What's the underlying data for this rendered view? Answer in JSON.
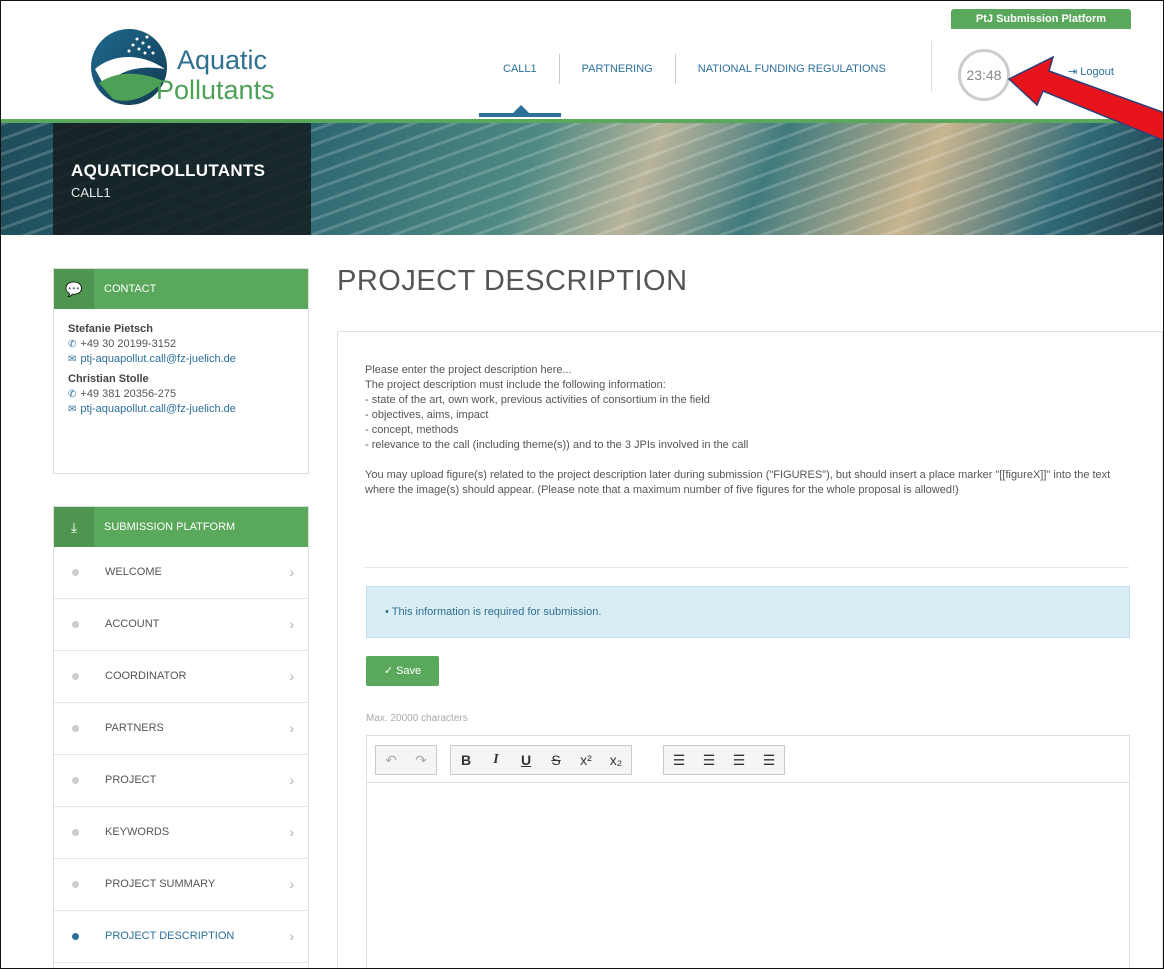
{
  "header": {
    "platform_label": "PtJ Submission Platform",
    "logo": {
      "line1": "Aquatic",
      "line2": "Pollutants"
    },
    "nav": [
      {
        "label": "CALL1",
        "active": true
      },
      {
        "label": "PARTNERING",
        "active": false
      },
      {
        "label": "NATIONAL FUNDING REGULATIONS",
        "active": false
      }
    ],
    "timer": "23:48",
    "logout_label": "Logout"
  },
  "banner": {
    "title": "AQUATICPOLLUTANTS",
    "subtitle": "CALL1"
  },
  "contact": {
    "heading": "CONTACT",
    "people": [
      {
        "name": "Stefanie Pietsch",
        "phone": "+49 30 20199-3152",
        "email": "ptj-aquapollut.call@fz-juelich.de"
      },
      {
        "name": "Christian Stolle",
        "phone": "+49 381 20356-275",
        "email": "ptj-aquapollut.call@fz-juelich.de"
      }
    ]
  },
  "submission": {
    "heading": "SUBMISSION PLATFORM",
    "items": [
      {
        "label": "WELCOME",
        "active": false
      },
      {
        "label": "ACCOUNT",
        "active": false
      },
      {
        "label": "COORDINATOR",
        "active": false
      },
      {
        "label": "PARTNERS",
        "active": false
      },
      {
        "label": "PROJECT",
        "active": false
      },
      {
        "label": "KEYWORDS",
        "active": false
      },
      {
        "label": "PROJECT SUMMARY",
        "active": false
      },
      {
        "label": "PROJECT DESCRIPTION",
        "active": true
      }
    ]
  },
  "main": {
    "title": "PROJECT DESCRIPTION",
    "description": [
      "Please enter the project description here...",
      "The project description must include the following information:",
      "- state of the art, own work, previous activities of consortium in the field",
      "- objectives, aims, impact",
      "- concept, methods",
      "- relevance to the call (including theme(s)) and to the 3 JPIs involved in the call"
    ],
    "note": "You may upload figure(s) related to the project description later during submission (\"FIGURES\"), but should insert a place marker \"[[figureX]]\" into the text where the image(s) should appear. (Please note that a maximum number of five figures for the whole proposal is allowed!)",
    "alert": "This information is required for submission.",
    "save_label": "Save",
    "max_chars": "Max. 20000 characters"
  },
  "colors": {
    "brand_green": "#5aa85b",
    "brand_blue": "#2c6f99",
    "alert_bg": "#d9edf4",
    "arrow_red": "#e8141b"
  },
  "editor": {
    "toolbar_icons": [
      "undo-icon",
      "redo-icon",
      "bold-icon",
      "italic-icon",
      "underline-icon",
      "strikethrough-icon",
      "superscript-icon",
      "subscript-icon",
      "align-left-icon",
      "align-center-icon",
      "align-right-icon",
      "align-justify-icon"
    ]
  }
}
